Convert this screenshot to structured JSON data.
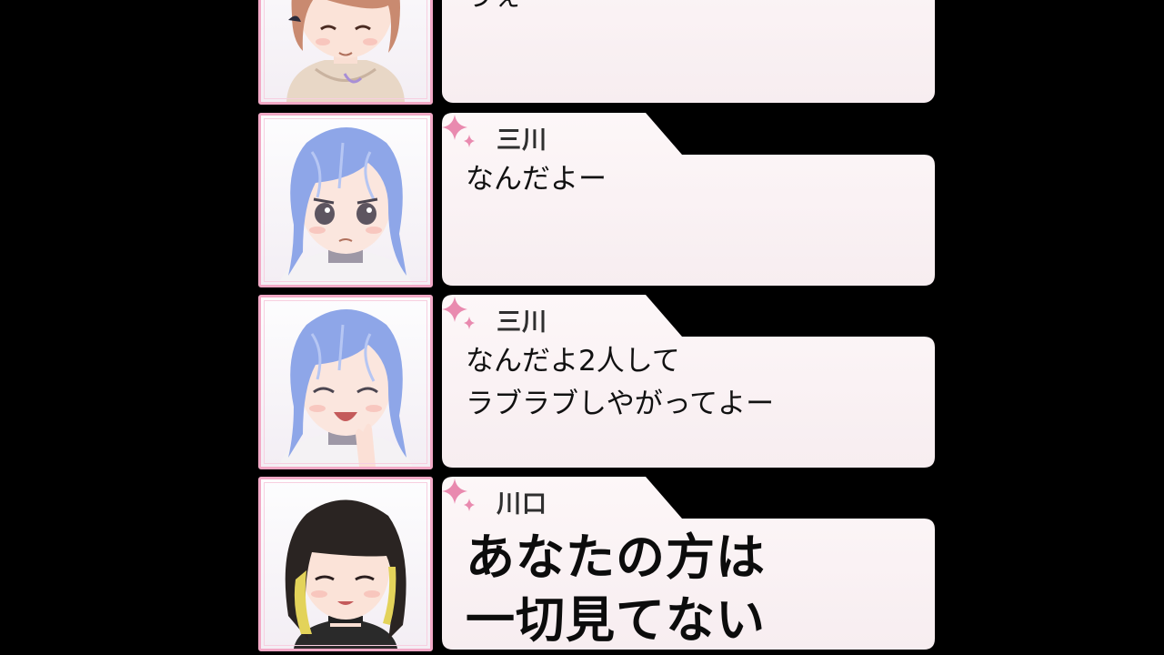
{
  "messages": [
    {
      "speaker": "",
      "text": "うぇ",
      "character": "brown-hair-girl-smiling",
      "emphasis": false
    },
    {
      "speaker": "三川",
      "text": "なんだよー",
      "character": "blue-hair-girl-worried",
      "emphasis": false
    },
    {
      "speaker": "三川",
      "text": "なんだよ2人して\nラブラブしやがってよー",
      "character": "blue-hair-girl-laughing",
      "emphasis": false
    },
    {
      "speaker": "川口",
      "text": "あなたの方は\n一切見てない",
      "character": "black-yellow-hair-girl-smiling",
      "emphasis": true
    }
  ],
  "colors": {
    "background": "#000000",
    "avatar_border": "#f2a9c6",
    "bubble_fill": "#fbf4f6",
    "sparkle": "#e98aaf"
  },
  "icons": {
    "speaker_marker": "sparkle-icon"
  }
}
